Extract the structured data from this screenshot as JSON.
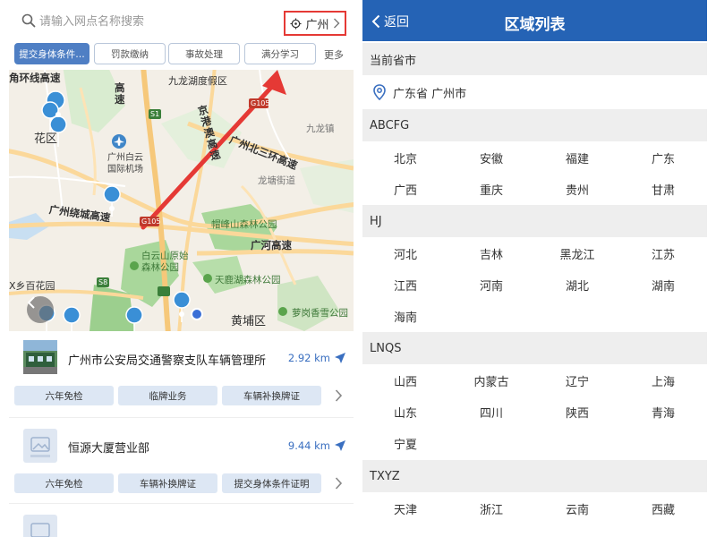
{
  "left": {
    "search": {
      "placeholder": "请输入网点名称搜索"
    },
    "city_button": {
      "label": "广州"
    },
    "filters": [
      {
        "label": "提交身体条件…",
        "active": true
      },
      {
        "label": "罚款缴纳",
        "active": false
      },
      {
        "label": "事故处理",
        "active": false
      },
      {
        "label": "满分学习",
        "active": false
      }
    ],
    "more_label": "更多",
    "map": {
      "labels": {
        "yonglong_line": "角环线高速",
        "jiulong_lake": "九龙湖度假区",
        "gaosu_a": "高速",
        "huadu": "花区",
        "baiyun_airport": "广州白云\n国际机场",
        "jing_gang_ao": "京港澳高速",
        "north_ring": "广州北三环高速",
        "jiulong": "九龙镇",
        "longtang": "龙塘街道",
        "ring_expressway": "广州绕城高速",
        "maofeng": "帽峰山森林公园",
        "baiyun_mountain": "白云山原始\n森林公园",
        "guanghe": "广河高速",
        "tianlu_lake": "天鹿湖森林公园",
        "huangpu": "黄埔区",
        "luogang": "萝岗香雪公园",
        "baiyunshan_village": "X乡百花园",
        "shield_s1": "S1",
        "shield_g105": "G105",
        "shield_s8": "S8",
        "shield_g105b": "G105"
      }
    },
    "stations": [
      {
        "name": "广州市公安局交通警察支队车辆管理所",
        "distance": "2.92 km",
        "tags": [
          "六年免检",
          "临牌业务",
          "车辆补换牌证"
        ]
      },
      {
        "name": "恒源大厦营业部",
        "distance": "9.44 km",
        "tags": [
          "六年免检",
          "车辆补换牌证",
          "提交身体条件证明"
        ]
      }
    ]
  },
  "right": {
    "back_label": "返回",
    "title": "区域列表",
    "current_header": "当前省市",
    "current_location": "广东省 广州市",
    "groups": [
      {
        "header": "ABCFG",
        "provinces": [
          "北京",
          "安徽",
          "福建",
          "广东",
          "广西",
          "重庆",
          "贵州",
          "甘肃"
        ]
      },
      {
        "header": "HJ",
        "provinces": [
          "河北",
          "吉林",
          "黑龙江",
          "江苏",
          "江西",
          "河南",
          "湖北",
          "湖南",
          "海南"
        ]
      },
      {
        "header": "LNQS",
        "provinces": [
          "山西",
          "内蒙古",
          "辽宁",
          "上海",
          "山东",
          "四川",
          "陕西",
          "青海",
          "宁夏"
        ]
      },
      {
        "header": "TXYZ",
        "provinces": [
          "天津",
          "浙江",
          "云南",
          "西藏"
        ]
      }
    ]
  },
  "colors": {
    "accent_blue": "#2563b5",
    "highlight_red": "#e53935",
    "tag_bg": "#dde7f4",
    "map_green": "#a9d79b",
    "map_road": "#f6c87a"
  }
}
